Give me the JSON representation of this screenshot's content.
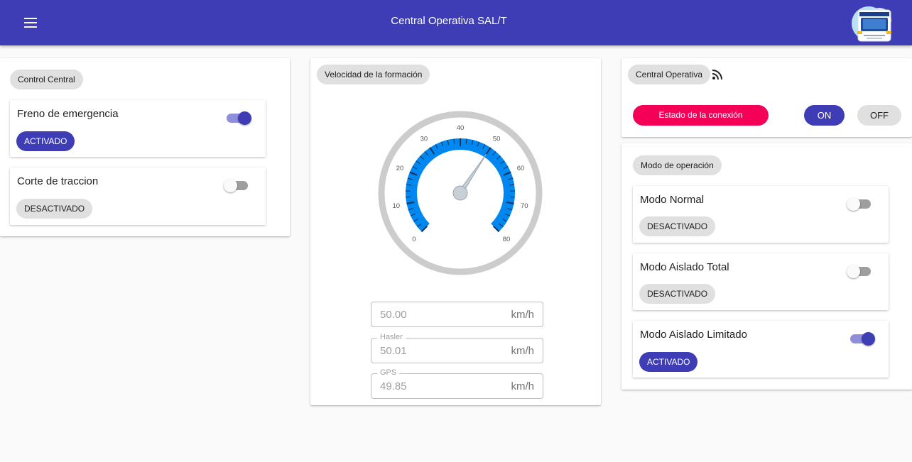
{
  "colors": {
    "primary": "#3f3db5",
    "gauge_arc": "#0088f0",
    "danger": "#f50057",
    "chip_grey": "#e0e0e0"
  },
  "header": {
    "title": "Central Operativa SAL/T",
    "menu_icon": "menu-icon",
    "logo": "train-logo"
  },
  "control_central": {
    "chip": "Control Central",
    "items": [
      {
        "label": "Freno de emergencia",
        "state": "ACTIVADO",
        "on": true
      },
      {
        "label": "Corte de traccion",
        "state": "DESACTIVADO",
        "on": false
      }
    ]
  },
  "velocidad": {
    "chip": "Velocidad de la formación",
    "gauge": {
      "min": 0,
      "max": 80,
      "value": 50.0,
      "ticks": [
        "0",
        "10",
        "20",
        "30",
        "40",
        "50",
        "60",
        "70",
        "80"
      ]
    },
    "fields": [
      {
        "label": "",
        "value": "50.00",
        "unit": "km/h"
      },
      {
        "label": "Hasler",
        "value": "50.01",
        "unit": "km/h"
      },
      {
        "label": "GPS",
        "value": "49.85",
        "unit": "km/h"
      }
    ]
  },
  "central_operativa": {
    "chip": "Central Operativa",
    "icon": "rss-feed-icon",
    "connection_label": "Estado de la conexión",
    "on_label": "ON",
    "off_label": "OFF"
  },
  "modo_operacion": {
    "chip": "Modo de operación",
    "items": [
      {
        "label": "Modo Normal",
        "state": "DESACTIVADO",
        "on": false
      },
      {
        "label": "Modo Aislado Total",
        "state": "DESACTIVADO",
        "on": false
      },
      {
        "label": "Modo Aislado Limitado",
        "state": "ACTIVADO",
        "on": true
      }
    ]
  }
}
